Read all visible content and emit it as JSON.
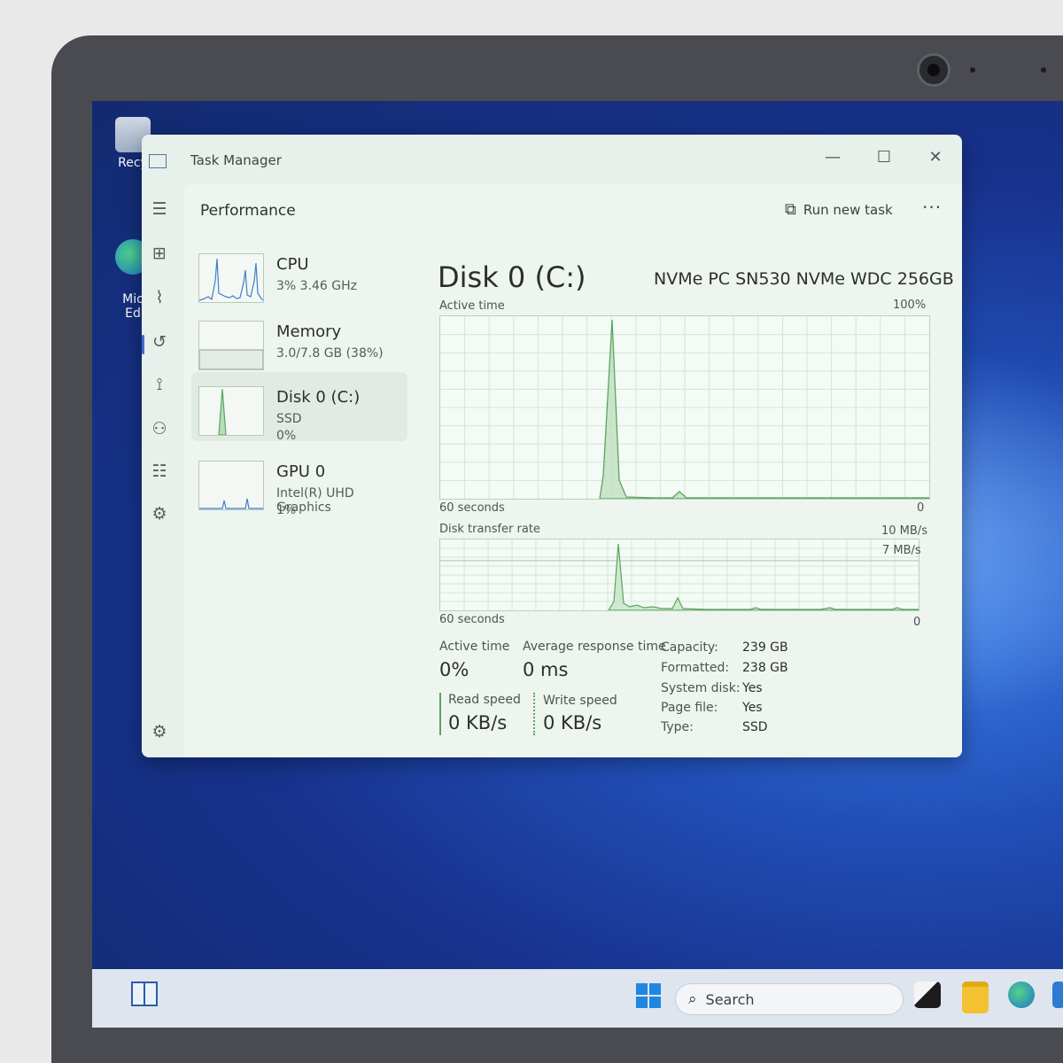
{
  "desktop": {
    "icons": [
      {
        "label": "Recy"
      },
      {
        "label": "Mic\nEd"
      }
    ]
  },
  "window": {
    "title": "Task Manager",
    "minimize": "—",
    "maximize": "☐",
    "close": "✕"
  },
  "rail": {
    "icons": [
      {
        "name": "hamburger-menu-icon",
        "glyph": "☰"
      },
      {
        "name": "processes-icon",
        "glyph": "⊞"
      },
      {
        "name": "performance-icon",
        "glyph": "⌇"
      },
      {
        "name": "app-history-icon",
        "glyph": "↺"
      },
      {
        "name": "startup-apps-icon",
        "glyph": "⟟"
      },
      {
        "name": "users-icon",
        "glyph": "⚇"
      },
      {
        "name": "details-icon",
        "glyph": "☷"
      },
      {
        "name": "services-icon",
        "glyph": "⚙"
      }
    ],
    "settings_glyph": "⚙"
  },
  "header": {
    "title": "Performance",
    "run_new_task": "Run new task",
    "more": "···"
  },
  "resources": [
    {
      "name": "CPU",
      "sub": "3%  3.46 GHz",
      "sub2": ""
    },
    {
      "name": "Memory",
      "sub": "3.0/7.8 GB (38%)",
      "sub2": ""
    },
    {
      "name": "Disk 0 (C:)",
      "sub": "SSD",
      "sub2": "0%"
    },
    {
      "name": "GPU 0",
      "sub": "Intel(R) UHD Graphics",
      "sub2": "1%"
    }
  ],
  "disk": {
    "title": "Disk 0 (C:)",
    "model": "NVMe PC SN530 NVMe WDC 256GB",
    "active_time_graph": {
      "label": "Active time",
      "max_label": "100%",
      "x_label": "60 seconds",
      "min_label": "0"
    },
    "transfer_graph": {
      "label": "Disk transfer rate",
      "max_label": "10 MB/s",
      "ref_label": "7 MB/s",
      "x_label": "60 seconds",
      "min_label": "0"
    },
    "stats": {
      "active_time_label": "Active time",
      "active_time_value": "0%",
      "avg_response_label": "Average response time",
      "avg_response_value": "0 ms",
      "read_label": "Read speed",
      "read_value": "0 KB/s",
      "write_label": "Write speed",
      "write_value": "0 KB/s"
    },
    "properties": [
      {
        "key": "Capacity:",
        "value": "239 GB"
      },
      {
        "key": "Formatted:",
        "value": "238 GB"
      },
      {
        "key": "System disk:",
        "value": "Yes"
      },
      {
        "key": "Page file:",
        "value": "Yes"
      },
      {
        "key": "Type:",
        "value": "SSD"
      }
    ]
  },
  "taskbar": {
    "search_placeholder": "Search"
  },
  "colors": {
    "graph_line": "#5aa55f",
    "cpu_line": "#3f7fc7",
    "accent": "#3f6fc9"
  }
}
